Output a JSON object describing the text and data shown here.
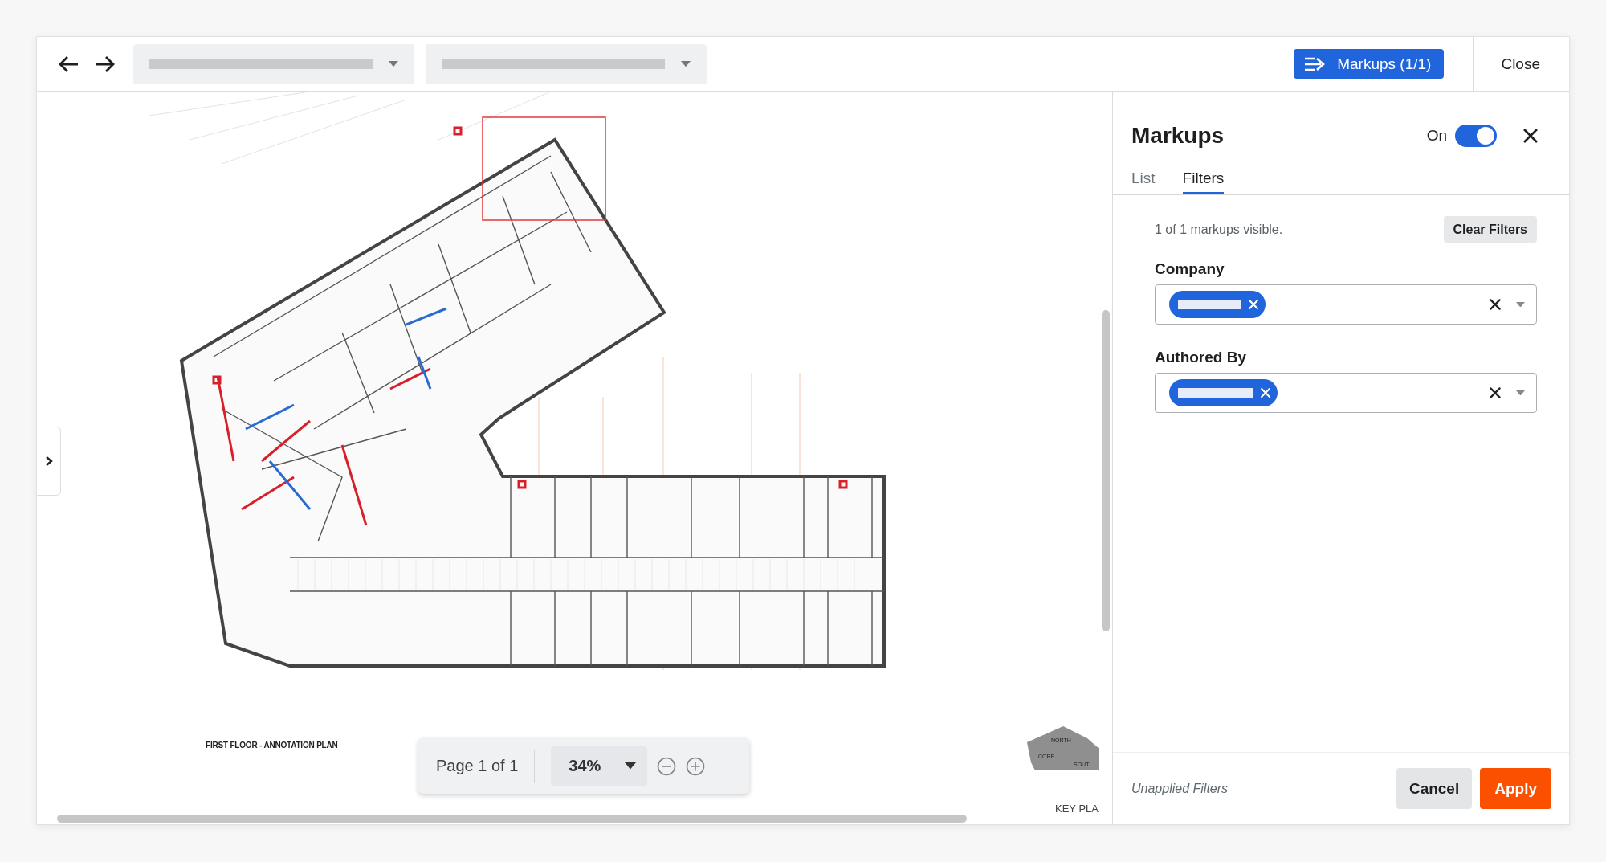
{
  "toolbar": {
    "markups_button": "Markups (1/1)",
    "close": "Close"
  },
  "document": {
    "sheet_title": "FIRST FLOOR - ANNOTATION PLAN",
    "key_plan": {
      "title": "KEY PLA",
      "zones": [
        "NORTH",
        "CORE",
        "SOUT"
      ]
    }
  },
  "viewer_controls": {
    "page": "Page 1 of 1",
    "zoom": "34%"
  },
  "panel": {
    "title": "Markups",
    "toggle_label": "On",
    "toggle_on": true,
    "tabs": [
      {
        "label": "List",
        "selected": false
      },
      {
        "label": "Filters",
        "selected": true
      }
    ],
    "status": "1 of 1 markups visible.",
    "clear_button": "Clear Filters",
    "filters": [
      {
        "label": "Company"
      },
      {
        "label": "Authored By"
      }
    ],
    "footer_note": "Unapplied Filters",
    "cancel": "Cancel",
    "apply": "Apply"
  }
}
